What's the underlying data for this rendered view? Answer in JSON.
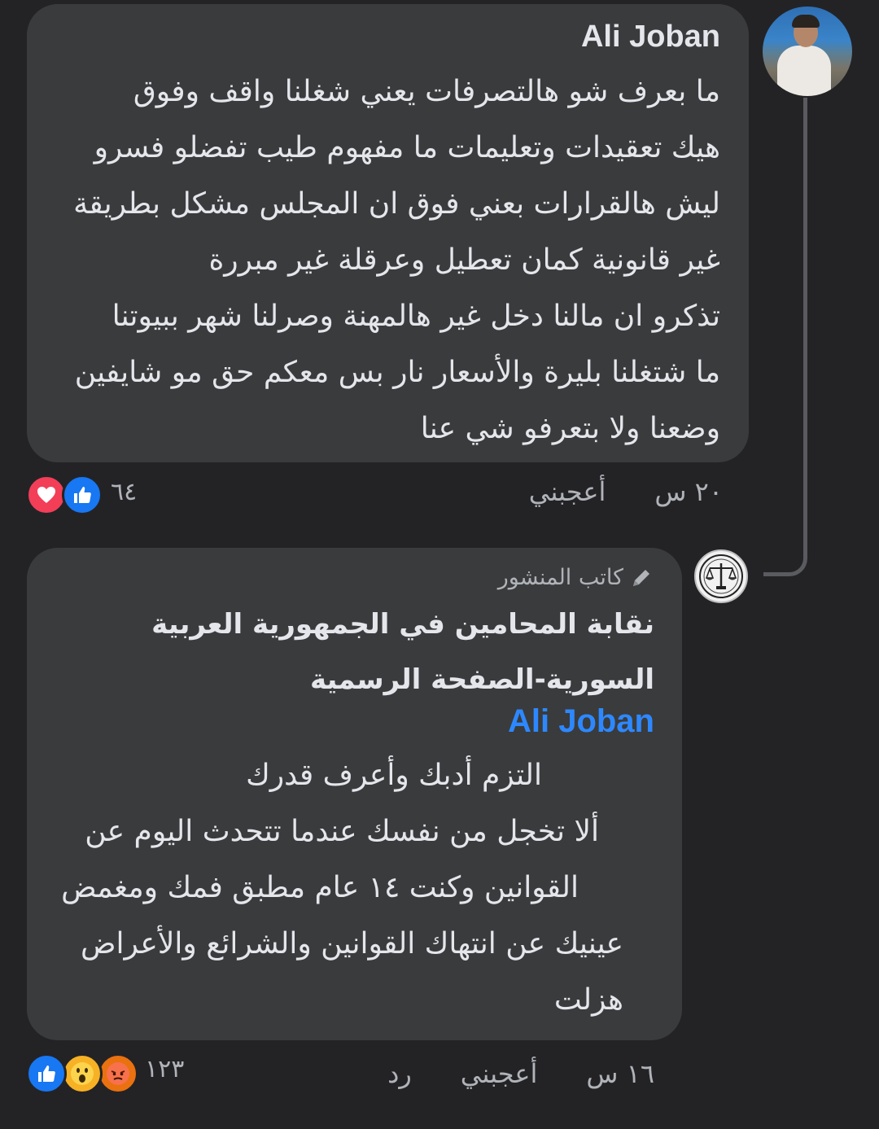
{
  "comment1": {
    "author": "Ali Joban",
    "lines": [
      "ما بعرف شو هالتصرفات يعني شغلنا واقف وفوق",
      "هيك تعقيدات وتعليمات ما مفهوم طيب تفضلو فسرو",
      "ليش هالقرارات بعني فوق ان المجلس مشكل بطريقة",
      "غير قانونية كمان تعطيل وعرقلة غير مبررة",
      "تذكرو ان مالنا دخل غير هالمهنة وصرلنا شهر ببيوتنا",
      "ما شتغلنا بليرة والأسعار نار بس معكم حق مو شايفين",
      "وضعنا ولا بتعرفو شي عنا"
    ],
    "time": "٢٠ س",
    "like_label": "أعجبني",
    "reaction_count": "٦٤",
    "reactions": [
      "like-icon",
      "love-icon"
    ]
  },
  "comment2": {
    "badge_label": "كاتب المنشور",
    "author_lines": [
      "نقابة المحامين في الجمهورية العربية",
      "السورية-الصفحة الرسمية"
    ],
    "mention": "Ali Joban",
    "lines": [
      "التزم أدبك وأعرف قدرك",
      "ألا تخجل من نفسك عندما تتحدث اليوم عن",
      "القوانين وكنت ١٤ عام مطبق فمك ومغمض",
      "عينيك عن انتهاك القوانين والشرائع والأعراض",
      "هزلت"
    ],
    "time": "١٦ س",
    "like_label": "أعجبني",
    "reply_label": "رد",
    "reaction_count": "١٢٣",
    "reactions": [
      "like-icon",
      "wow-icon",
      "angry-icon"
    ]
  },
  "colors": {
    "background": "#232326",
    "bubble": "#3a3b3c",
    "text": "#e4e6eb",
    "muted": "#b0b3b8",
    "mention": "#2d88ff",
    "like": "#1877f2",
    "love": "#f33e58"
  }
}
